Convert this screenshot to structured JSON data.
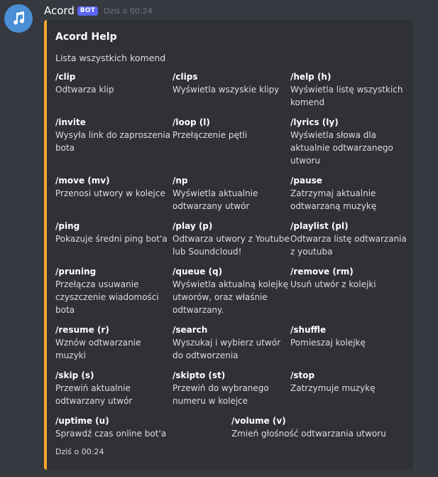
{
  "message": {
    "username": "Acord",
    "badge": "BOT",
    "timestamp": "Dziś o 00:24",
    "avatar_icon": "music-note-icon"
  },
  "embed": {
    "accent_color": "#f9a62b",
    "title": "Acord Help",
    "description": "Lista wszystkich komend",
    "footer": "Dziś o 00:24",
    "fields": [
      {
        "name": "/clip",
        "value": "Odtwarza klip"
      },
      {
        "name": "/clips",
        "value": "Wyświetla wszyskie klipy"
      },
      {
        "name": "/help (h)",
        "value": "Wyświetla listę wszystkich komend"
      },
      {
        "name": "/invite",
        "value": "Wysyła link do zaproszenia bota"
      },
      {
        "name": "/loop (l)",
        "value": "Przełączenie pętli"
      },
      {
        "name": "/lyrics (ly)",
        "value": "Wyświetla słowa dla aktualnie odtwarzanego utworu"
      },
      {
        "name": "/move (mv)",
        "value": "Przenosi utwory w kolejce"
      },
      {
        "name": "/np",
        "value": "Wyświetla aktualnie odtwarzany utwór"
      },
      {
        "name": "/pause",
        "value": "Zatrzymaj aktualnie odtwarzaną muzykę"
      },
      {
        "name": "/ping",
        "value": "Pokazuje średni ping bot'a"
      },
      {
        "name": "/play (p)",
        "value": "Odtwarza utwory z Youtube lub Soundcloud!"
      },
      {
        "name": "/playlist (pl)",
        "value": "Odtwarza listę odtwarzania z youtuba"
      },
      {
        "name": "/pruning",
        "value": "Przełącza usuwanie czyszczenie wiadomości bota"
      },
      {
        "name": "/queue (q)",
        "value": "Wyświetla aktualną kolejkę utworów, oraz właśnie odtwarzany."
      },
      {
        "name": "/remove (rm)",
        "value": "Usuń utwór z kolejki"
      },
      {
        "name": "/resume (r)",
        "value": "Wznów odtwarzanie muzyki"
      },
      {
        "name": "/search",
        "value": "Wyszukaj i wybierz utwór do odtworzenia"
      },
      {
        "name": "/shuffle",
        "value": "Pomieszaj kolejkę"
      },
      {
        "name": "/skip (s)",
        "value": "Przewiń aktualnie odtwarzany utwór"
      },
      {
        "name": "/skipto (st)",
        "value": "Przewiń do wybranego numeru w kolejce"
      },
      {
        "name": "/stop",
        "value": "Zatrzymuje muzykę"
      },
      {
        "name": "/uptime (u)",
        "value": "Sprawdź czas online bot'a"
      },
      {
        "name": "/volume (v)",
        "value": "Zmień głośność odtwarzania utworu"
      }
    ]
  }
}
